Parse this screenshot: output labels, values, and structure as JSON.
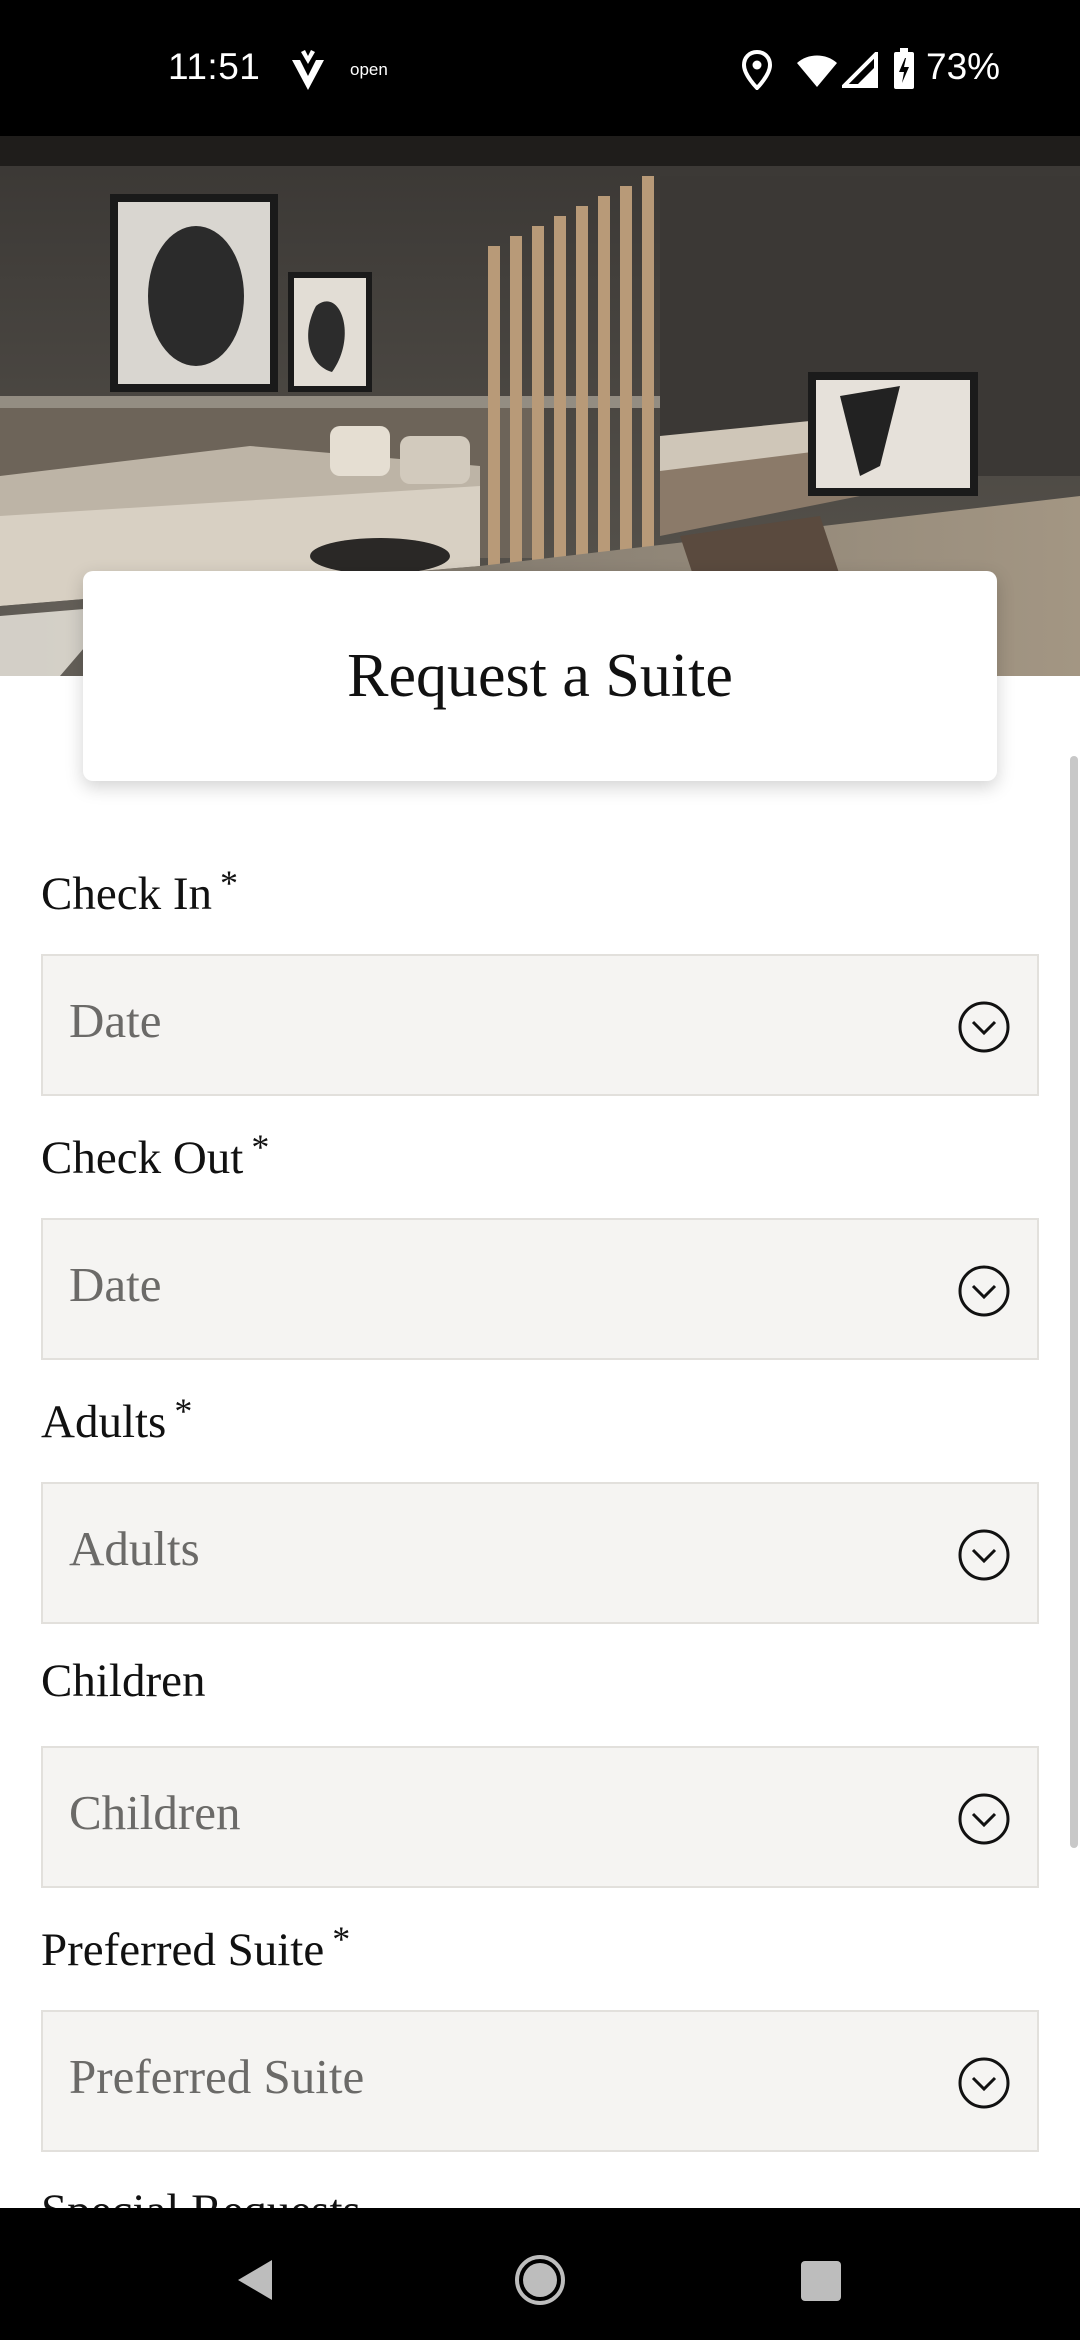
{
  "status_bar": {
    "time": "11:51",
    "app_label": "open",
    "battery": "73%"
  },
  "hero": {
    "image": "hotel-suite-interior-photo"
  },
  "title": "Request a Suite",
  "form": {
    "required_mark": "*",
    "fields": [
      {
        "label": "Check In",
        "placeholder": "Date"
      },
      {
        "label": "Check Out",
        "placeholder": "Date"
      },
      {
        "label": "Adults",
        "placeholder": "Adults"
      },
      {
        "label": "Children",
        "placeholder": "Children"
      },
      {
        "label": "Preferred Suite",
        "placeholder": "Preferred Suite"
      }
    ],
    "next_label": "Special Requests"
  },
  "nav_bar": {
    "back": "back-icon",
    "home": "home-icon",
    "recents": "recents-icon"
  }
}
